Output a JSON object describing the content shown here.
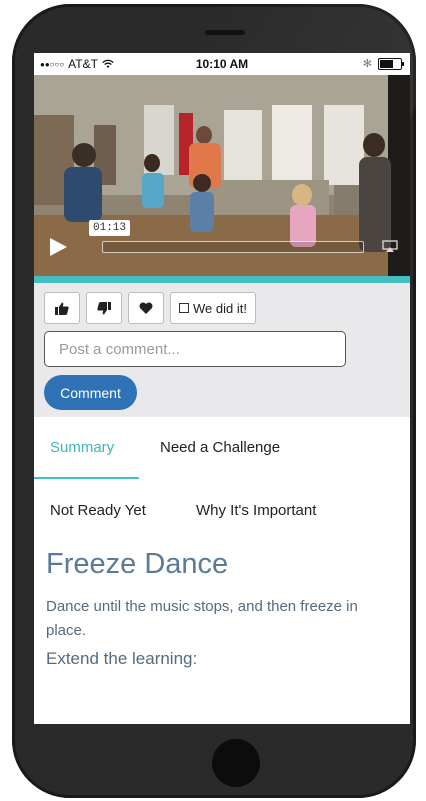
{
  "status_bar": {
    "signal": "●●○○○",
    "carrier": "AT&T",
    "time": "10:10 AM",
    "bluetooth": "✻"
  },
  "video": {
    "current_time": "01:13",
    "progress_fraction": 0.0
  },
  "actions": {
    "did_it_label": "We did it!",
    "comment_placeholder": "Post a comment...",
    "comment_button": "Comment"
  },
  "tabs": {
    "summary": "Summary",
    "challenge": "Need a Challenge",
    "not_ready": "Not Ready Yet",
    "why": "Why It's Important"
  },
  "activity": {
    "title": "Freeze Dance",
    "description": "Dance until the music stops, and then freeze in place.",
    "extend": "Extend the learning:"
  },
  "colors": {
    "accent": "#43bfc1",
    "button_blue": "#2f72b6",
    "title_blue": "#5a7a95"
  }
}
